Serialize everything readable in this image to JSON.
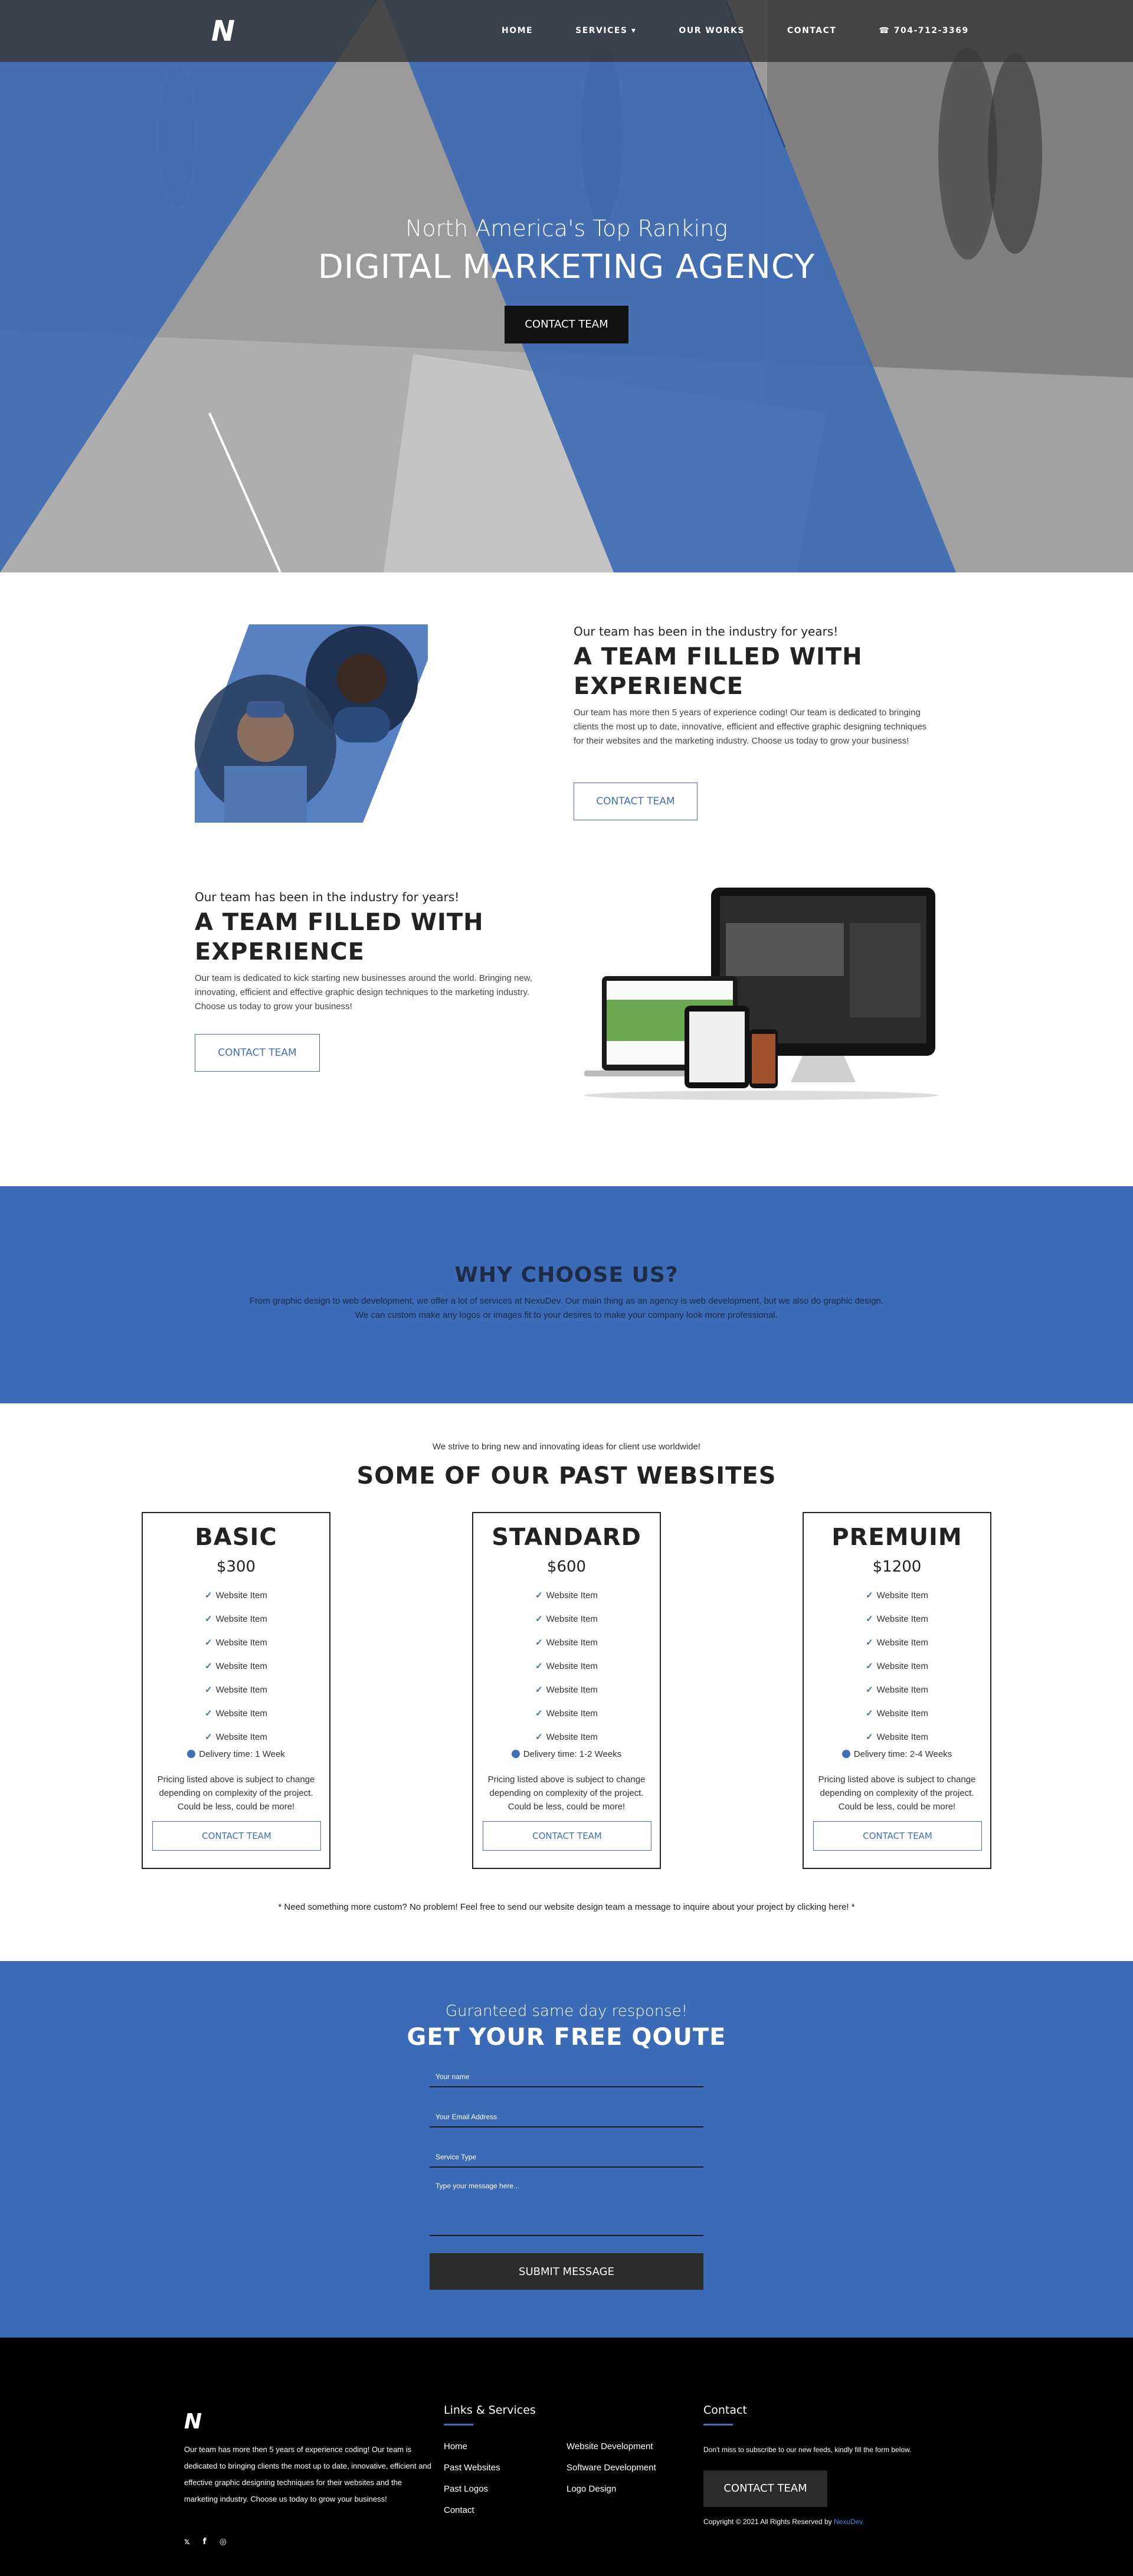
{
  "colors": {
    "accent": "#3b6bb6",
    "dark": "#111111",
    "footer": "#000000"
  },
  "nav": {
    "logo": "N",
    "links": [
      "HOME",
      "SERVICES ▾",
      "OUR WORKS",
      "CONTACT"
    ],
    "phone": "☎ 704-712-3369"
  },
  "hero": {
    "subtitle": "North America's Top Ranking",
    "title": "DIGITAL MARKETING AGENCY",
    "button": "CONTACT TEAM"
  },
  "team1": {
    "kicker": "Our team has been in the industry for years!",
    "title": "A TEAM FILLED WITH EXPERIENCE",
    "text": "Our team has more then 5 years of experience coding! Our team is dedicated to bringing clients the most up to date, innovative, efficient and effective graphic designing techniques for their websites and the marketing industry. Choose us today to grow your business!",
    "button": "CONTACT TEAM"
  },
  "team2": {
    "kicker": "Our team has been in the industry for years!",
    "title": "A TEAM FILLED WITH EXPERIENCE",
    "text": "Our team is dedicated to kick starting new businesses around the world. Bringing new, innovating, efficient and effective graphic design techniques to the marketing industry. Choose us today to grow your business!",
    "button": "CONTACT TEAM"
  },
  "why": {
    "title": "WHY CHOOSE US?",
    "line1": "From graphic design to web development, we offer a lot of services at NexuDev. Our main thing as an agency is web development, but we also do graphic design.",
    "line2": "We can custom make any logos or images fit to your desires to make your company look more professional."
  },
  "pricing": {
    "kicker": "We strive to bring new and innovating ideas for client use worldwide!",
    "title": "SOME OF OUR PAST WEBSITES",
    "plans": [
      {
        "name": "BASIC",
        "price": "$300",
        "items": [
          "Website Item",
          "Website Item",
          "Website Item",
          "Website Item",
          "Website Item",
          "Website Item",
          "Website Item"
        ],
        "delivery": "Delivery time: 1 Week",
        "note": "Pricing listed above is subject to change depending on complexity of the project. Could be less, could be more!",
        "button": "CONTACT TEAM"
      },
      {
        "name": "STANDARD",
        "price": "$600",
        "items": [
          "Website Item",
          "Website Item",
          "Website Item",
          "Website Item",
          "Website Item",
          "Website Item",
          "Website Item"
        ],
        "delivery": "Delivery time: 1-2 Weeks",
        "note": "Pricing listed above is subject to change depending on complexity of the project. Could be less, could be more!",
        "button": "CONTACT TEAM"
      },
      {
        "name": "PREMUIM",
        "price": "$1200",
        "items": [
          "Website Item",
          "Website Item",
          "Website Item",
          "Website Item",
          "Website Item",
          "Website Item",
          "Website Item"
        ],
        "delivery": "Delivery time: 2-4 Weeks",
        "note": "Pricing listed above is subject to change depending on complexity of the project. Could be less, could be more!",
        "button": "CONTACT TEAM"
      }
    ],
    "footnote": "* Need something more custom? No problem! Feel free to send our website design team a message to inquire about your project by clicking here! *"
  },
  "quote": {
    "kicker": "Guranteed same day response!",
    "title": "GET YOUR FREE QOUTE",
    "name_placeholder": "Your name",
    "email_placeholder": "Your Email Address",
    "service_placeholder": "Service Type",
    "message_placeholder": "Type your message here...",
    "submit": "SUBMIT MESSAGE"
  },
  "footer": {
    "logo": "N",
    "about": "Our team has more then 5 years of experience coding! Our team is dedicated to bringing clients the most up to date, innovative, efficient and effective graphic designing techniques for their websites and the marketing industry. Choose us today to grow your business!",
    "socials": [
      "𝕩",
      "f",
      "◎"
    ],
    "links_title": "Links & Services",
    "links_col1": [
      "Home",
      "Past Websites",
      "Past Logos",
      "Contact"
    ],
    "links_col2": [
      "Website Development",
      "Software Development",
      "Logo Design"
    ],
    "contact_title": "Contact",
    "contact_text": "Don't miss to subscribe to our new feeds, kindly fill the form below.",
    "contact_button": "CONTACT TEAM",
    "copyright": "Copyright © 2021 All Rights Reserved by ",
    "brand": "NexuDev."
  }
}
